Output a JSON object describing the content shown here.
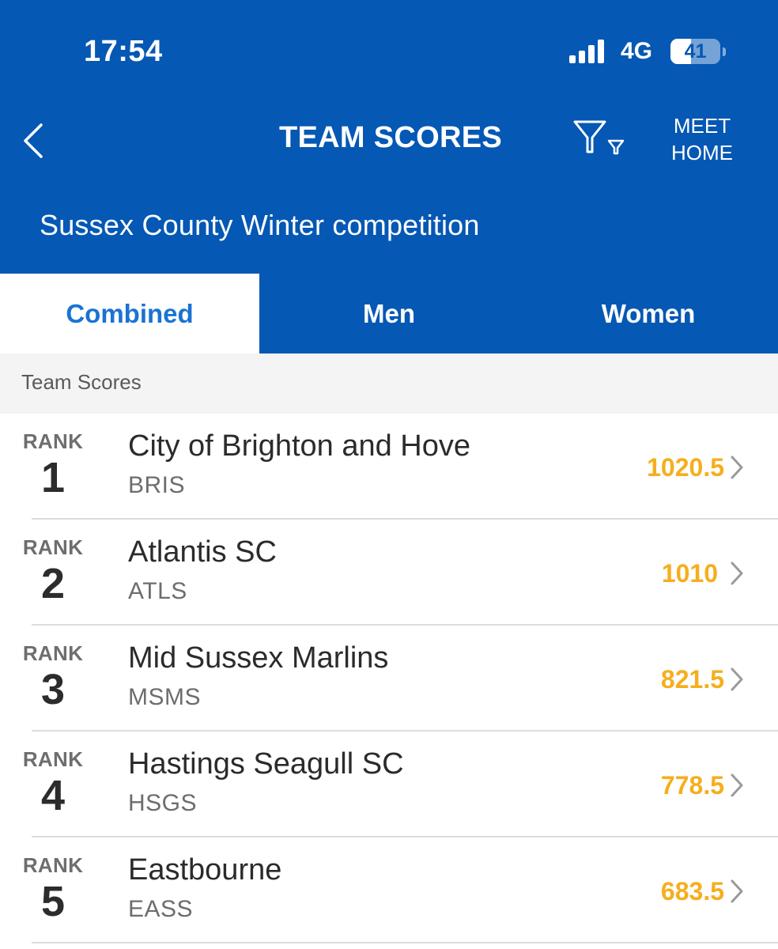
{
  "status_bar": {
    "time": "17:54",
    "network": "4G",
    "battery": "41",
    "battery_level": 0.41
  },
  "nav": {
    "title": "TEAM SCORES",
    "meet_home_line1": "MEET",
    "meet_home_line2": "HOME",
    "back_icon": "chevron-left-icon",
    "filter_icon": "filter-icon"
  },
  "meet": {
    "name": "Sussex County Winter competition"
  },
  "tabs": [
    {
      "label": "Combined",
      "active": true
    },
    {
      "label": "Men",
      "active": false
    },
    {
      "label": "Women",
      "active": false
    }
  ],
  "section": {
    "title": "Team Scores"
  },
  "rank_label": "RANK",
  "teams": [
    {
      "rank": "1",
      "name": "City of Brighton and Hove",
      "code": "BRIS",
      "score": "1020.5"
    },
    {
      "rank": "2",
      "name": "Atlantis SC",
      "code": "ATLS",
      "score": "1010"
    },
    {
      "rank": "3",
      "name": "Mid Sussex Marlins",
      "code": "MSMS",
      "score": "821.5"
    },
    {
      "rank": "4",
      "name": "Hastings Seagull SC",
      "code": "HSGS",
      "score": "778.5"
    },
    {
      "rank": "5",
      "name": "Eastbourne",
      "code": "EASS",
      "score": "683.5"
    }
  ],
  "colors": {
    "brand_blue": "#0558b4",
    "active_tab_text": "#1a73d2",
    "score": "#f6ae1d"
  }
}
